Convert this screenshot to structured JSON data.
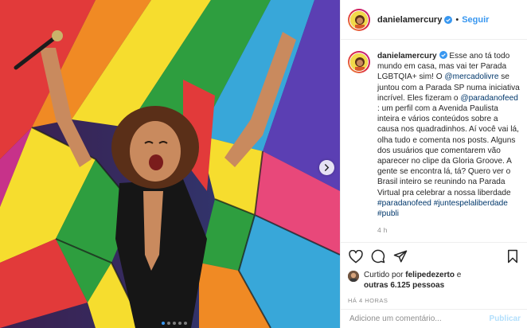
{
  "header": {
    "username": "danielamercury",
    "separator": "•",
    "follow_label": "Seguir"
  },
  "caption": {
    "username": "danielamercury",
    "segments": [
      {
        "type": "text",
        "text": " Esse ano tá todo mundo em casa, mas vai ter Parada LGBTQIA+ sim! O "
      },
      {
        "type": "mention",
        "text": "@mercadolivre"
      },
      {
        "type": "text",
        "text": " se juntou com a Parada SP numa iniciativa incrível. Eles fizeram o "
      },
      {
        "type": "mention",
        "text": "@paradanofeed"
      },
      {
        "type": "text",
        "text": " : um perfil com a Avenida Paulista inteira e vários conteúdos sobre a causa nos quadradinhos. Aí você vai lá, olha tudo e comenta nos posts. Alguns dos usuários que comentarem vão aparecer no clipe da Gloria Groove. A gente se encontra lá, tá? Quero ver o Brasil inteiro se reunindo na Parada Virtual pra celebrar a nossa liberdade "
      },
      {
        "type": "hashtag",
        "text": "#paradanofeed"
      },
      {
        "type": "text",
        "text": " "
      },
      {
        "type": "hashtag",
        "text": "#juntespelaliberdade"
      },
      {
        "type": "text",
        "text": " "
      },
      {
        "type": "hashtag",
        "text": "#publi"
      }
    ],
    "time_ago": "4 h"
  },
  "likes": {
    "prefix": "Curtido por ",
    "liker": "felipedezerto",
    "middle": " e",
    "others": "outras 6.125 pessoas"
  },
  "posted_label": "HÁ 4 HORAS",
  "comment": {
    "placeholder": "Adicione um comentário...",
    "publish_label": "Publicar"
  },
  "carousel": {
    "slide_count": 5,
    "active_index": 0
  },
  "colors": {
    "accent": "#3897f0",
    "mention": "#00376b",
    "muted": "#8e8e8e",
    "publish_disabled": "#b2dffc"
  },
  "icons": [
    "verified-badge-icon",
    "heart-icon",
    "comment-icon",
    "share-icon",
    "bookmark-icon",
    "chevron-right-icon"
  ]
}
